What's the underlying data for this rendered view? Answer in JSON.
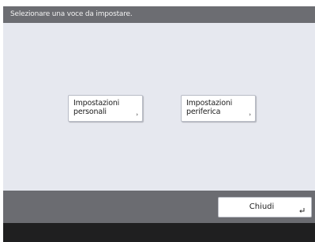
{
  "title_bar": {
    "text": "Selezionare una voce da impostare."
  },
  "options": [
    {
      "label": "Impostazioni\npersonali"
    },
    {
      "label": "Impostazioni\nperiferica"
    }
  ],
  "footer": {
    "close_label": "Chiudi"
  },
  "colors": {
    "title_bar_bg": "#6c6d72",
    "content_bg": "#e6e8ef",
    "footer_bg": "#6b6c71",
    "bottom_strip_bg": "#1f1f20",
    "button_bg": "#ffffff"
  },
  "icons": {
    "option_chevron": "chevron-right-icon",
    "close_enter": "enter-icon"
  }
}
